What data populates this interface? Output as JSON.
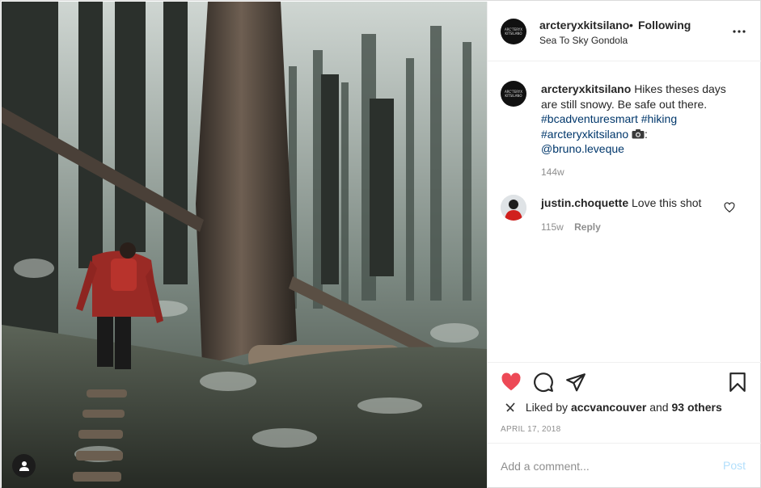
{
  "post": {
    "username": "arcteryxkitsilano",
    "dot": "•",
    "follow_label": "Following",
    "location": "Sea To Sky Gondola",
    "avatar_text": "ARC'TERYX KITSILANO",
    "caption_text": "Hikes theses days are still snowy. Be safe out there.",
    "hashtags": [
      "#bcadventuresmart",
      "#hiking",
      "#arcteryxkitsilano"
    ],
    "camera_icon": "camera-icon",
    "mention": "@bruno.leveque",
    "caption_time": "144w"
  },
  "comment": {
    "username": "justin.choquette",
    "text": "Love this shot",
    "time": "115w",
    "reply_label": "Reply"
  },
  "actions": {
    "liked_state": true,
    "like_color": "#ed4956",
    "liked_by_prefix": "Liked by",
    "liked_by_user": "accvancouver",
    "and_label": "and",
    "others_label": "93 others",
    "date": "APRIL 17, 2018"
  },
  "add_comment": {
    "placeholder": "Add a comment...",
    "post_label": "Post",
    "post_color": "#b2dffc"
  }
}
